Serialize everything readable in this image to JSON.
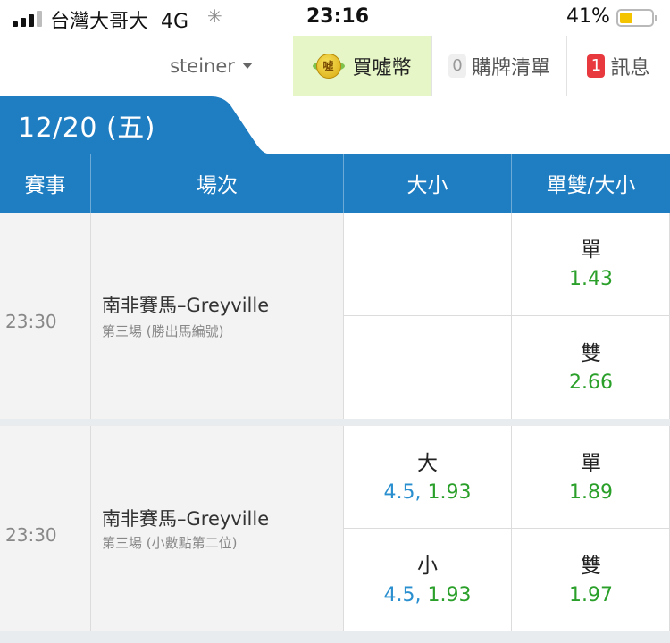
{
  "status_bar": {
    "carrier": "台灣大哥大",
    "network": "4G",
    "time": "23:16",
    "battery_pct": "41%",
    "battery_level": 0.41,
    "battery_color": "#f5c400"
  },
  "nav": {
    "username": "steiner",
    "buy_label": "買噓幣",
    "coin_text": "噓",
    "cart_count": "0",
    "cart_label": "購牌清單",
    "msg_count": "1",
    "msg_label": "訊息"
  },
  "date_tab": {
    "label": "12/20 (五)",
    "color": "#1f7dc1"
  },
  "table_header": {
    "event": "賽事",
    "race": "場次",
    "over_under": "大小",
    "odd_even": "單雙/大小"
  },
  "rows": [
    {
      "time": "23:30",
      "race_name": "南非賽馬–Greyville",
      "race_sub": "第三場 (勝出馬編號)",
      "over_under": [
        {
          "label": "",
          "line": "",
          "odds": ""
        },
        {
          "label": "",
          "line": "",
          "odds": ""
        }
      ],
      "odd_even": [
        {
          "label": "單",
          "odds": "1.43"
        },
        {
          "label": "雙",
          "odds": "2.66"
        }
      ]
    },
    {
      "time": "23:30",
      "race_name": "南非賽馬–Greyville",
      "race_sub": "第三場 (小數點第二位)",
      "over_under": [
        {
          "label": "大",
          "line": "4.5,",
          "odds": "1.93"
        },
        {
          "label": "小",
          "line": "4.5,",
          "odds": "1.93"
        }
      ],
      "odd_even": [
        {
          "label": "單",
          "odds": "1.89"
        },
        {
          "label": "雙",
          "odds": "1.97"
        }
      ]
    }
  ],
  "colors": {
    "primary_blue": "#1f7dc1",
    "odds_green": "#2aa02a",
    "line_blue": "#2a8fcf",
    "buy_bg": "#e6f6c6",
    "badge_red": "#e8393f"
  },
  "icons": [
    "signal-icon",
    "loading-spinner-icon",
    "battery-icon",
    "dropdown-caret-icon",
    "coin-icon"
  ]
}
